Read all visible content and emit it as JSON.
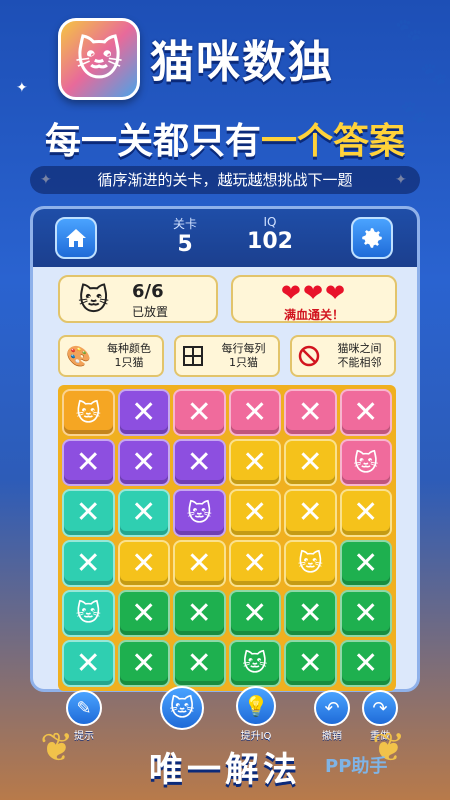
{
  "app": {
    "title": "猫咪数独"
  },
  "headline": {
    "part1": "每一关都只有",
    "part2": "一个答案"
  },
  "subline": "循序渐进的关卡，越玩越想挑战下一题",
  "stats": {
    "level_label": "关卡",
    "level_value": "5",
    "iq_label": "IQ",
    "iq_value": "102"
  },
  "progress": {
    "count": "6/6",
    "label": "已放置"
  },
  "lives": {
    "hearts": 3,
    "label": "满血通关！"
  },
  "rules": [
    {
      "icon": "palette-icon",
      "line1": "每种颜色",
      "line2": "1只猫"
    },
    {
      "icon": "grid-icon",
      "line1": "每行每列",
      "line2": "1只猫"
    },
    {
      "icon": "no-entry-icon",
      "line1": "猫咪之间",
      "line2": "不能相邻"
    }
  ],
  "colors": {
    "orange": "#f5a623",
    "purple": "#8d4fe0",
    "pink": "#f06b9c",
    "yellow": "#f5c21b",
    "teal": "#2fcfb1",
    "green": "#1eb04f"
  },
  "board": [
    [
      "orange:cat",
      "purple:x",
      "pink:x",
      "pink:x",
      "pink:x",
      "pink:x"
    ],
    [
      "purple:x",
      "purple:x",
      "purple:x",
      "yellow:x",
      "yellow:x",
      "pink:cat"
    ],
    [
      "teal:x",
      "teal:x",
      "purple:cat",
      "yellow:x",
      "yellow:x",
      "yellow:x"
    ],
    [
      "teal:x",
      "yellow:x",
      "yellow:x",
      "yellow:x",
      "yellow:cat",
      "green:x"
    ],
    [
      "teal:cat",
      "green:x",
      "green:x",
      "green:x",
      "green:x",
      "green:x"
    ],
    [
      "teal:x",
      "green:x",
      "green:x",
      "green:cat",
      "green:x",
      "green:x"
    ]
  ],
  "toolbar": {
    "hint": "提示",
    "iq": "提升IQ",
    "undo": "撤销",
    "redo": "重做"
  },
  "footer": "唯一解法",
  "watermark": "PP助手"
}
